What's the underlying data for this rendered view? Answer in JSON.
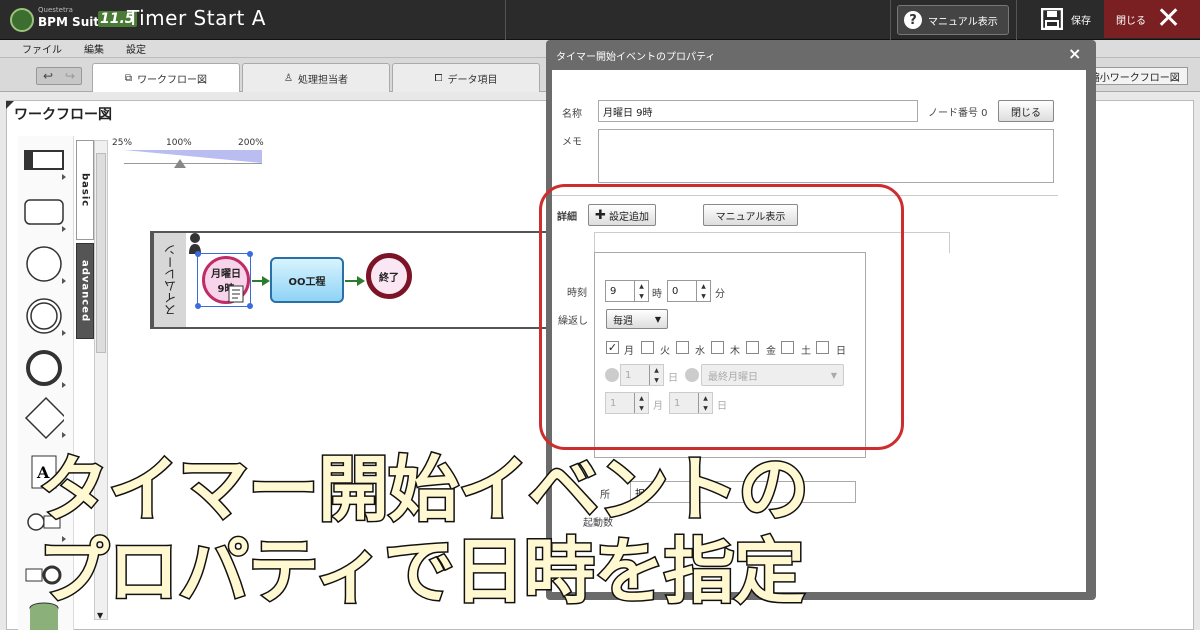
{
  "app": {
    "logo_company": "Questetra",
    "logo_name": "BPM Suite",
    "logo_version": "11.5",
    "title": "Timer Start A",
    "manual_button": "マニュアル表示",
    "save_button": "保存",
    "close_button": "閉じる"
  },
  "menu": [
    "ファイル",
    "編集",
    "設定"
  ],
  "tabs": [
    {
      "label": "ワークフロー図",
      "icon": "workflow-icon",
      "active": true
    },
    {
      "label": "処理担当者",
      "icon": "user-icon",
      "active": false
    },
    {
      "label": "データ項目",
      "icon": "copy-icon",
      "active": false
    }
  ],
  "shrink_button": "縮小ワークフロー図",
  "workflow": {
    "heading": "ワークフロー図",
    "zoom_labels": [
      "25%",
      "100%",
      "200%"
    ],
    "palette_tabs": [
      "basic",
      "advanced"
    ],
    "swimlane": "スイムレーン",
    "start_node": {
      "line1": "月曜日",
      "line2": "9時"
    },
    "task_node": "OO工程",
    "end_node": "終了"
  },
  "dialog": {
    "title": "タイマー開始イベントのプロパティ",
    "name_label": "名称",
    "name_value": "月曜日 9時",
    "node_number_label": "ノード番号 0",
    "close_button": "閉じる",
    "memo_label": "メモ",
    "detail_label": "詳細",
    "add_setting_button": "設定追加",
    "manual_button": "マニュアル表示",
    "time_label": "時刻",
    "hour_value": "9",
    "hour_unit": "時",
    "minute_value": "0",
    "minute_unit": "分",
    "repeat_label": "繰返し",
    "repeat_value": "毎週",
    "weekdays": [
      {
        "label": "月",
        "checked": true
      },
      {
        "label": "火",
        "checked": false
      },
      {
        "label": "水",
        "checked": false
      },
      {
        "label": "木",
        "checked": false
      },
      {
        "label": "金",
        "checked": false
      },
      {
        "label": "土",
        "checked": false
      },
      {
        "label": "日",
        "checked": false
      }
    ],
    "day_value": "1",
    "day_unit": "日",
    "last_weekday_value": "最終月曜日",
    "month_value": "1",
    "month_unit": "月",
    "month_day_value": "1",
    "month_day_unit": "日",
    "partial_label_1": "所",
    "partial_value_1": "担一",
    "start_count_label": "起動数"
  },
  "banner": {
    "line1": "タイマー開始イベントの",
    "line2": "プロパティで日時を指定"
  },
  "colors": {
    "highlight_border": "#cc2d2d",
    "close_button_bg": "#7a1f22",
    "start_event_border": "#c02c66",
    "end_event_border": "#7a1426",
    "task_border": "#2a6fa6"
  }
}
